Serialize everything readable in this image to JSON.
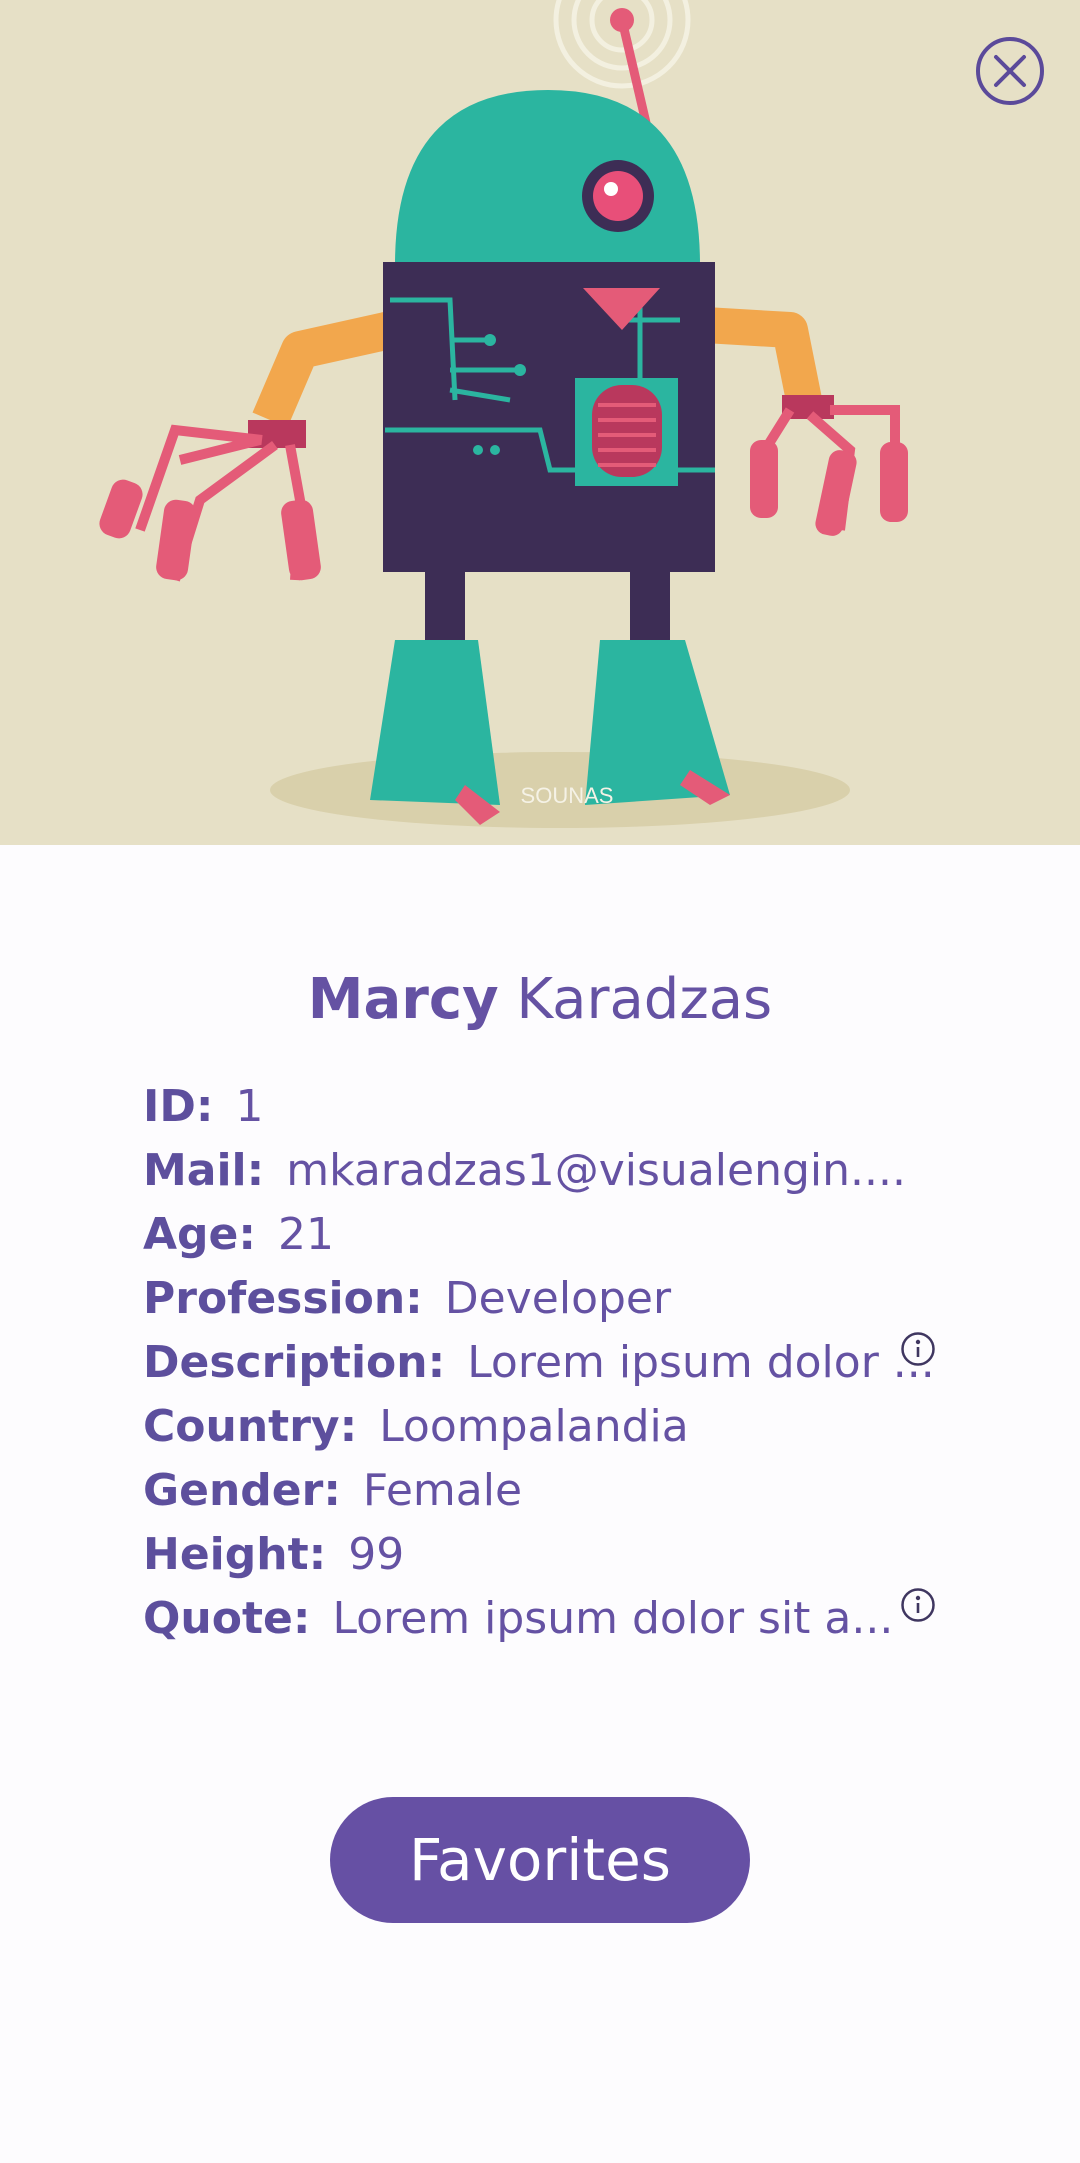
{
  "header": {
    "image_alt": "Robot illustration",
    "watermark": "SOUNAS",
    "close_icon": "close-icon"
  },
  "profile": {
    "first_name": "Marcy",
    "last_name": "Karadzas"
  },
  "fields": [
    {
      "label": "ID:",
      "value": "1"
    },
    {
      "label": "Mail:",
      "value": "mkaradzas1@visualengin...."
    },
    {
      "label": "Age:",
      "value": "21"
    },
    {
      "label": "Profession:",
      "value": "Developer"
    },
    {
      "label": "Description:",
      "value": "Lorem ipsum dolor ...",
      "info_icon": "info-icon"
    },
    {
      "label": "Country:",
      "value": "Loompalandia"
    },
    {
      "label": "Gender:",
      "value": "Female"
    },
    {
      "label": "Height:",
      "value": "99"
    },
    {
      "label": "Quote:",
      "value": "Lorem ipsum dolor sit a...",
      "info_icon": "info-icon"
    }
  ],
  "actions": {
    "favorites_label": "Favorites"
  },
  "colors": {
    "accent": "#6650a4",
    "text": "#6552a3",
    "hero_background": "#e6e0c6"
  }
}
